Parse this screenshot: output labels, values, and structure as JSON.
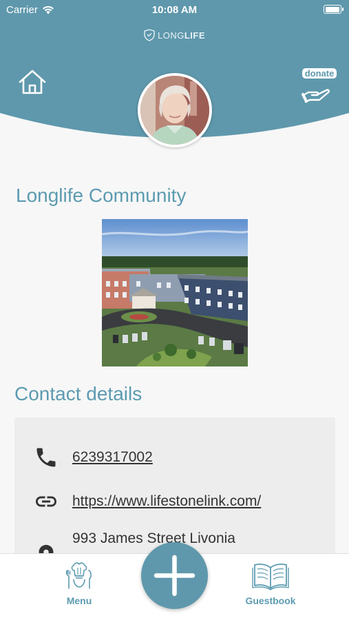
{
  "status_bar": {
    "carrier": "Carrier",
    "time": "10:08 AM",
    "battery_level": 1.0
  },
  "header": {
    "logo_text_light": "LONG",
    "logo_text_bold": "LIFE",
    "home_icon": "home-icon",
    "donate_label": "donate",
    "donate_icon": "hand-donate-icon",
    "avatar": "resident-avatar"
  },
  "community": {
    "title": "Longlife Community",
    "photo": "community-building-aerial-photo"
  },
  "contact": {
    "title": "Contact details",
    "phone": "6239317002",
    "website": "https://www.lifestonelink.com/",
    "address": "993 James Street Livonia"
  },
  "tab_bar": {
    "menu_label": "Menu",
    "guestbook_label": "Guestbook",
    "add_icon": "plus-icon"
  },
  "colors": {
    "brand": "#5f98ac",
    "title": "#5c9bb0",
    "card": "#ededed",
    "background": "#f7f7f7"
  }
}
